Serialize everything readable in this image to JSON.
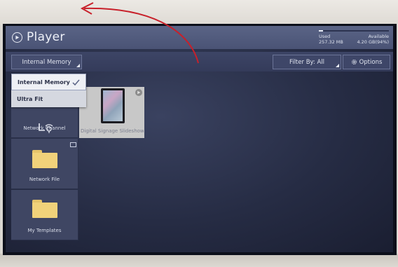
{
  "app": {
    "title": "Player"
  },
  "storage": {
    "used_label": "Used",
    "used_value": "257.32 MB",
    "available_label": "Available",
    "available_value": "4.20 GB(94%)",
    "used_fraction": 0.06
  },
  "toolbar": {
    "memory_select": "Internal Memory",
    "filter_label": "Filter By: All",
    "options_label": "Options"
  },
  "memory_dropdown": {
    "options": [
      {
        "label": "Internal Memory",
        "selected": true
      },
      {
        "label": "Ultra Fit",
        "selected": false
      }
    ]
  },
  "sidebar": {
    "items": [
      {
        "label": "Network Channel"
      },
      {
        "label": "Network File"
      },
      {
        "label": "My Templates"
      }
    ]
  },
  "content": {
    "items": [
      {
        "label": "Digital Signage Slideshow..."
      }
    ]
  },
  "colors": {
    "background": "#262c44",
    "topbar": "#4a5375",
    "folder": "#f1d27a",
    "annotation_arrow": "#c8202a"
  }
}
